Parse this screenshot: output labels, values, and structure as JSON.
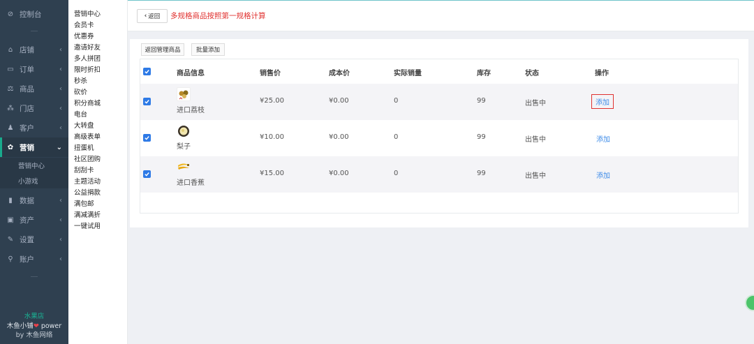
{
  "nav": {
    "items": [
      {
        "icon": "dashboard-icon",
        "glyph": "⊘",
        "label": "控制台",
        "arrow": ""
      },
      {
        "icon": "store-icon",
        "glyph": "⌂",
        "label": "店铺",
        "arrow": "‹"
      },
      {
        "icon": "order-icon",
        "glyph": "▭",
        "label": "订单",
        "arrow": "‹"
      },
      {
        "icon": "goods-icon",
        "glyph": "⚖",
        "label": "商品",
        "arrow": "‹"
      },
      {
        "icon": "outlet-icon",
        "glyph": "⁂",
        "label": "门店",
        "arrow": "‹"
      },
      {
        "icon": "customer-icon",
        "glyph": "♟",
        "label": "客户",
        "arrow": "‹"
      },
      {
        "icon": "marketing-icon",
        "glyph": "✿",
        "label": "营销",
        "arrow": "⌄"
      },
      {
        "icon": "data-icon",
        "glyph": "▮",
        "label": "数据",
        "arrow": "‹"
      },
      {
        "icon": "asset-icon",
        "glyph": "▣",
        "label": "资产",
        "arrow": "‹"
      },
      {
        "icon": "settings-icon",
        "glyph": "✎",
        "label": "设置",
        "arrow": "‹"
      },
      {
        "icon": "account-icon",
        "glyph": "⚲",
        "label": "账户",
        "arrow": "‹"
      }
    ],
    "sub_items": [
      "营销中心",
      "小游戏"
    ],
    "shop_name": "水果店",
    "power_left": "木鱼小铺",
    "power_right": "power",
    "by_text": "by 木鱼网络"
  },
  "submenu": [
    "营销中心",
    "会员卡",
    "优惠券",
    "邀请好友",
    "多人拼团",
    "限时折扣",
    "秒杀",
    "砍价",
    "积分商城",
    "电台",
    "大转盘",
    "高级表单",
    "扭蛋机",
    "社区团购",
    "刮刮卡",
    "主题活动",
    "公益捐款",
    "满包邮",
    "满减满折",
    "一键试用"
  ],
  "topbar": {
    "back_label": "返回",
    "title": "多规格商品按照第一规格计算"
  },
  "actions": {
    "back_manage": "返回管理商品",
    "batch_add": "批量添加"
  },
  "table": {
    "headers": [
      "商品信息",
      "销售价",
      "成本价",
      "实际销量",
      "库存",
      "状态",
      "操作"
    ],
    "rows": [
      {
        "name": "进口荔枝",
        "price": "¥25.00",
        "cost": "¥0.00",
        "sales": "0",
        "stock": "99",
        "status": "出售中",
        "action": "添加"
      },
      {
        "name": "梨子",
        "price": "¥10.00",
        "cost": "¥0.00",
        "sales": "0",
        "stock": "99",
        "status": "出售中",
        "action": "添加"
      },
      {
        "name": "进口香蕉",
        "price": "¥15.00",
        "cost": "¥0.00",
        "sales": "0",
        "stock": "99",
        "status": "出售中",
        "action": "添加"
      }
    ]
  },
  "colors": {
    "nav_bg": "#2f4050",
    "accent": "#19aa8d",
    "checkbox": "#2e7ae6",
    "title_red": "#e0312f",
    "link_blue": "#3f8ce8"
  }
}
